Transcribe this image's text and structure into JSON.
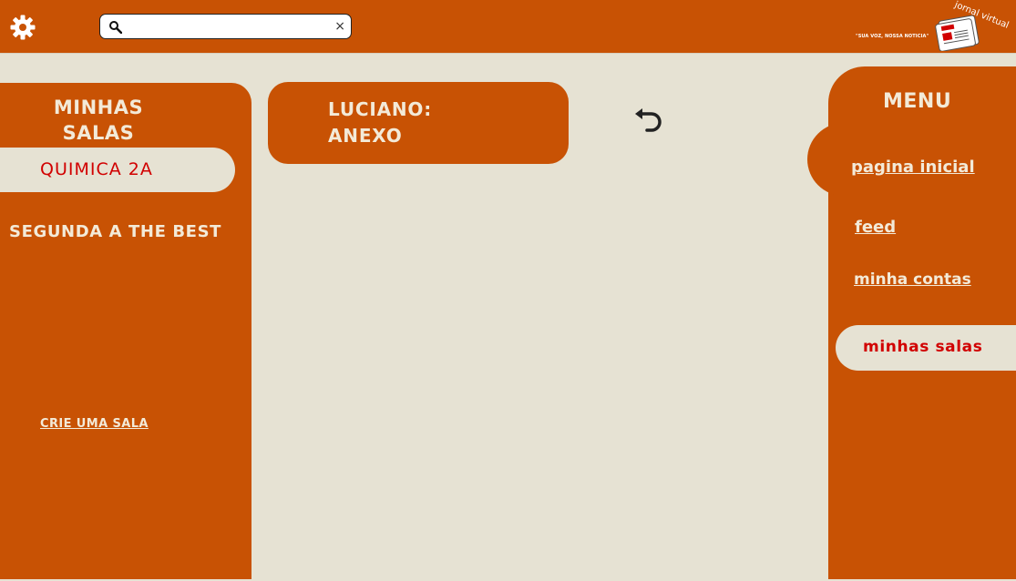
{
  "header": {
    "settings_icon": "gear-icon",
    "search": {
      "value": "",
      "placeholder": "",
      "search_icon": "search-icon",
      "clear_label": "×"
    },
    "brand": {
      "slogan": "\"SUA VOZ, NOSSA NOTICIA\"",
      "name": "jornal virtual",
      "logo_icon": "newspaper-icon"
    }
  },
  "left_panel": {
    "title_line1": "MINHAS",
    "title_line2": "SALAS",
    "active_room": "QUIMICA 2A",
    "rooms": [
      "SEGUNDA A THE BEST"
    ],
    "create_room_label": "CRIE UMA SALA"
  },
  "post": {
    "author": "LUCIANO:",
    "content": "ANEXO",
    "back_icon": "undo-arrow-icon"
  },
  "menu": {
    "title": "MENU",
    "items": [
      {
        "label": "pagina inicial"
      },
      {
        "label": "feed"
      },
      {
        "label": "minha contas"
      },
      {
        "label": "minhas salas"
      }
    ],
    "active_index": 3
  },
  "colors": {
    "accent": "#c85204",
    "background": "#e6e2d3",
    "active_text": "#d10000",
    "light_text": "#f3ead8"
  }
}
